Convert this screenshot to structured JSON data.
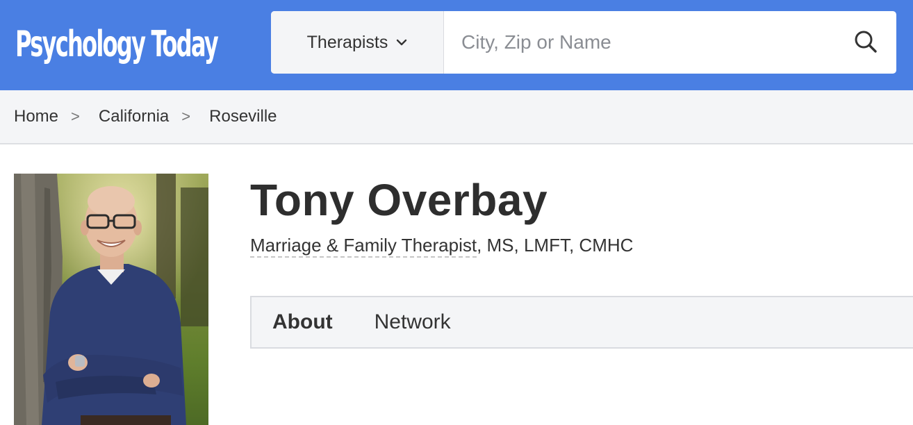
{
  "header": {
    "logo": "Psychology Today",
    "search_type_label": "Therapists",
    "search_placeholder": "City, Zip or Name",
    "brand_color": "#4a7fe3"
  },
  "breadcrumb": {
    "items": [
      "Home",
      "California",
      "Roseville"
    ],
    "separator": ">"
  },
  "profile": {
    "name": "Tony Overbay",
    "title": "Marriage & Family Therapist",
    "credentials": ", MS, LMFT, CMHC"
  },
  "tabs": [
    {
      "label": "About",
      "active": true
    },
    {
      "label": "Network",
      "active": false
    }
  ],
  "icons": {
    "search": "search-icon",
    "chevron": "chevron-down-icon"
  }
}
